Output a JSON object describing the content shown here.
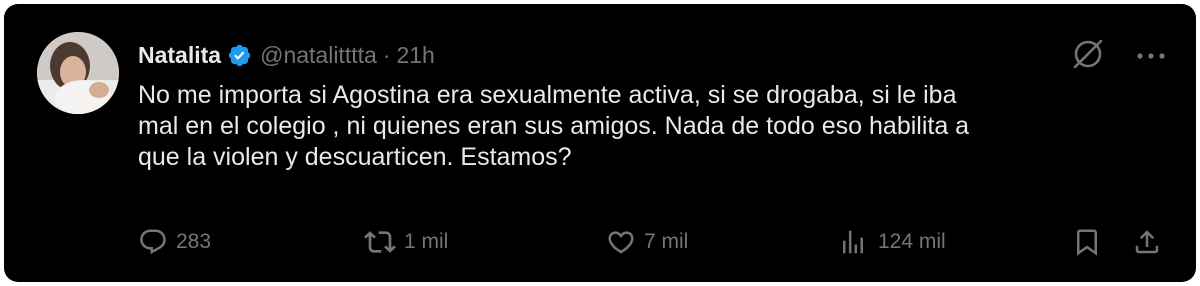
{
  "tweet": {
    "author": {
      "display_name": "Natalita",
      "handle": "@natalitttta",
      "verified": true,
      "avatar_icon": "profile-photo"
    },
    "separator": "·",
    "time": "21h",
    "text": "No me importa si Agostina era sexualmente activa, si se drogaba, si le iba\nmal en el colegio , ni quienes eran sus amigos. Nada de todo eso habilita a\nque la violen y descuarticen. Estamos?",
    "stats": {
      "replies": "283",
      "reposts": "1 mil",
      "likes": "7 mil",
      "views": "124 mil"
    }
  },
  "icons": {
    "verified": "verified-badge-icon",
    "grok": "grok-icon",
    "more": "more-icon",
    "reply": "reply-icon",
    "repost": "repost-icon",
    "like": "like-icon",
    "views": "views-icon",
    "bookmark": "bookmark-icon",
    "share": "share-icon"
  },
  "colors": {
    "background": "#000000",
    "primary_text": "#e7e9ea",
    "secondary_text": "#71767b",
    "verified_blue": "#1d9bf0"
  }
}
